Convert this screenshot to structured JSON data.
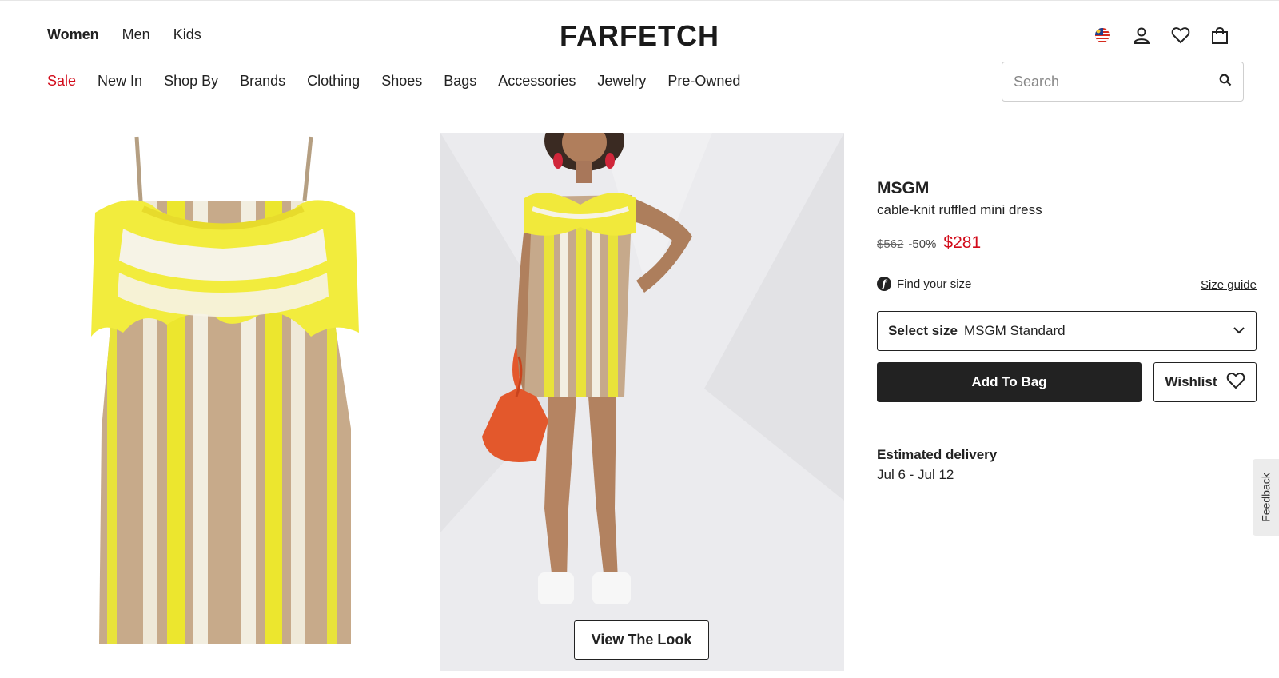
{
  "header": {
    "logo": "FARFETCH",
    "gender_tabs": [
      {
        "label": "Women",
        "active": true
      },
      {
        "label": "Men",
        "active": false
      },
      {
        "label": "Kids",
        "active": false
      }
    ],
    "icons": [
      "flag-icon",
      "account-icon",
      "wishlist-heart-icon",
      "shopping-bag-icon"
    ]
  },
  "nav": {
    "items": [
      "Sale",
      "New In",
      "Shop By",
      "Brands",
      "Clothing",
      "Shoes",
      "Bags",
      "Accessories",
      "Jewelry",
      "Pre-Owned"
    ],
    "sale_color": "#d20b1a"
  },
  "search": {
    "placeholder": "Search",
    "value": ""
  },
  "gallery": {
    "view_look_label": "View The Look"
  },
  "product": {
    "brand": "MSGM",
    "name": "cable-knit ruffled mini dress",
    "original_price": "$562",
    "discount": "-50%",
    "sale_price": "$281",
    "find_size_label": "Find your size",
    "size_guide_label": "Size guide",
    "size_select_label": "Select size",
    "size_select_value": "MSGM Standard",
    "add_to_bag_label": "Add To Bag",
    "wishlist_label": "Wishlist",
    "estimated_delivery_label": "Estimated delivery",
    "estimated_delivery_dates": "Jul 6 - Jul 12"
  },
  "feedback_label": "Feedback",
  "colors": {
    "accent_red": "#d20b1a",
    "primary_dark": "#222222"
  }
}
